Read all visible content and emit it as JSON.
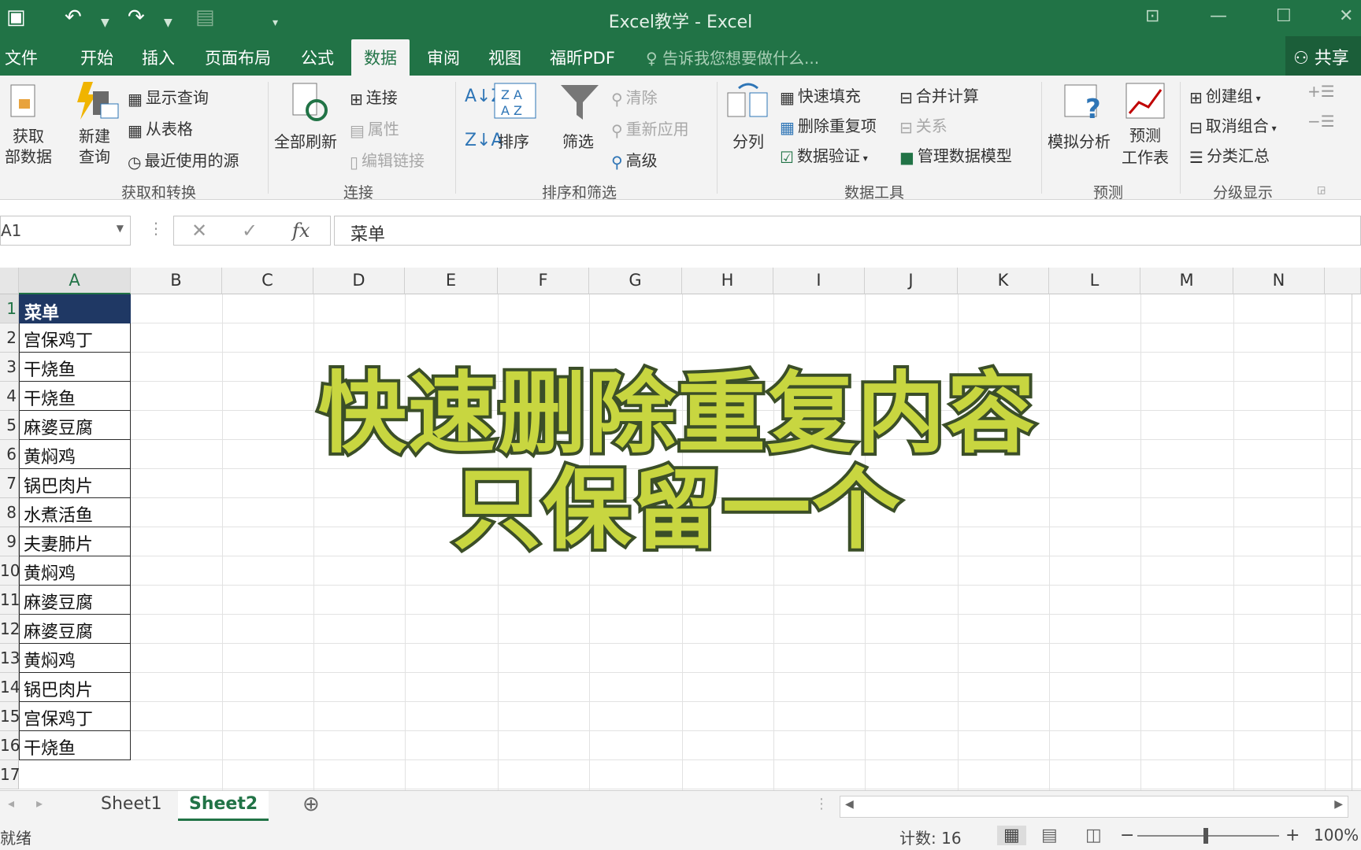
{
  "window": {
    "title": "Excel教学 - Excel"
  },
  "quick_access": {
    "save_icon": "save-icon",
    "undo_icon": "undo-icon",
    "redo_icon": "redo-icon"
  },
  "tabs": [
    {
      "label": "文件"
    },
    {
      "label": "开始"
    },
    {
      "label": "插入"
    },
    {
      "label": "页面布局"
    },
    {
      "label": "公式"
    },
    {
      "label": "数据",
      "active": true
    },
    {
      "label": "审阅"
    },
    {
      "label": "视图"
    },
    {
      "label": "福昕PDF"
    }
  ],
  "tellme": "告诉我您想要做什么...",
  "share": "共享",
  "ribbon": {
    "get_transform": {
      "label": "获取和转换",
      "get_data": [
        "获取",
        "部数据"
      ],
      "new_query": [
        "新建",
        "查询"
      ],
      "show_query": "显示查询",
      "from_table": "从表格",
      "recent_sources": "最近使用的源"
    },
    "connections": {
      "label": "连接",
      "refresh_all": "全部刷新",
      "connections": "连接",
      "properties": "属性",
      "edit_links": "编辑链接"
    },
    "sort_filter": {
      "label": "排序和筛选",
      "sort": "排序",
      "filter": "筛选",
      "clear": "清除",
      "reapply": "重新应用",
      "advanced": "高级"
    },
    "data_tools": {
      "label": "数据工具",
      "text_to_columns": "分列",
      "flash_fill": "快速填充",
      "remove_duplicates": "删除重复项",
      "data_validation": "数据验证",
      "consolidate": "合并计算",
      "relationships": "关系",
      "manage_model": "管理数据模型"
    },
    "forecast": {
      "label": "预测",
      "what_if": "模拟分析",
      "forecast_sheet": [
        "预测",
        "工作表"
      ]
    },
    "outline": {
      "label": "分级显示",
      "group": "创建组",
      "ungroup": "取消组合",
      "subtotal": "分类汇总"
    }
  },
  "formula_bar": {
    "name_box": "A1",
    "fx": "fx",
    "cancel": "✕",
    "enter": "✓",
    "content": "菜单"
  },
  "columns": [
    "A",
    "B",
    "C",
    "D",
    "E",
    "F",
    "G",
    "H",
    "I",
    "J",
    "K",
    "L",
    "M",
    "N"
  ],
  "rows": [
    "1",
    "2",
    "3",
    "4",
    "5",
    "6",
    "7",
    "8",
    "9",
    "10",
    "11",
    "12",
    "13",
    "14",
    "15",
    "16",
    "17"
  ],
  "cells_A": [
    "菜单",
    "宫保鸡丁",
    "干烧鱼",
    "干烧鱼",
    "麻婆豆腐",
    "黄焖鸡",
    "锅巴肉片",
    "水煮活鱼",
    "夫妻肺片",
    "黄焖鸡",
    "麻婆豆腐",
    "麻婆豆腐",
    "黄焖鸡",
    "锅巴肉片",
    "宫保鸡丁",
    "干烧鱼"
  ],
  "overlay": {
    "line1": "快速删除重复内容",
    "line2": "只保留一个"
  },
  "sheets": [
    {
      "label": "Sheet1"
    },
    {
      "label": "Sheet2",
      "active": true
    }
  ],
  "status": {
    "mode": "就绪",
    "count": "计数: 16",
    "zoom": "100%"
  }
}
